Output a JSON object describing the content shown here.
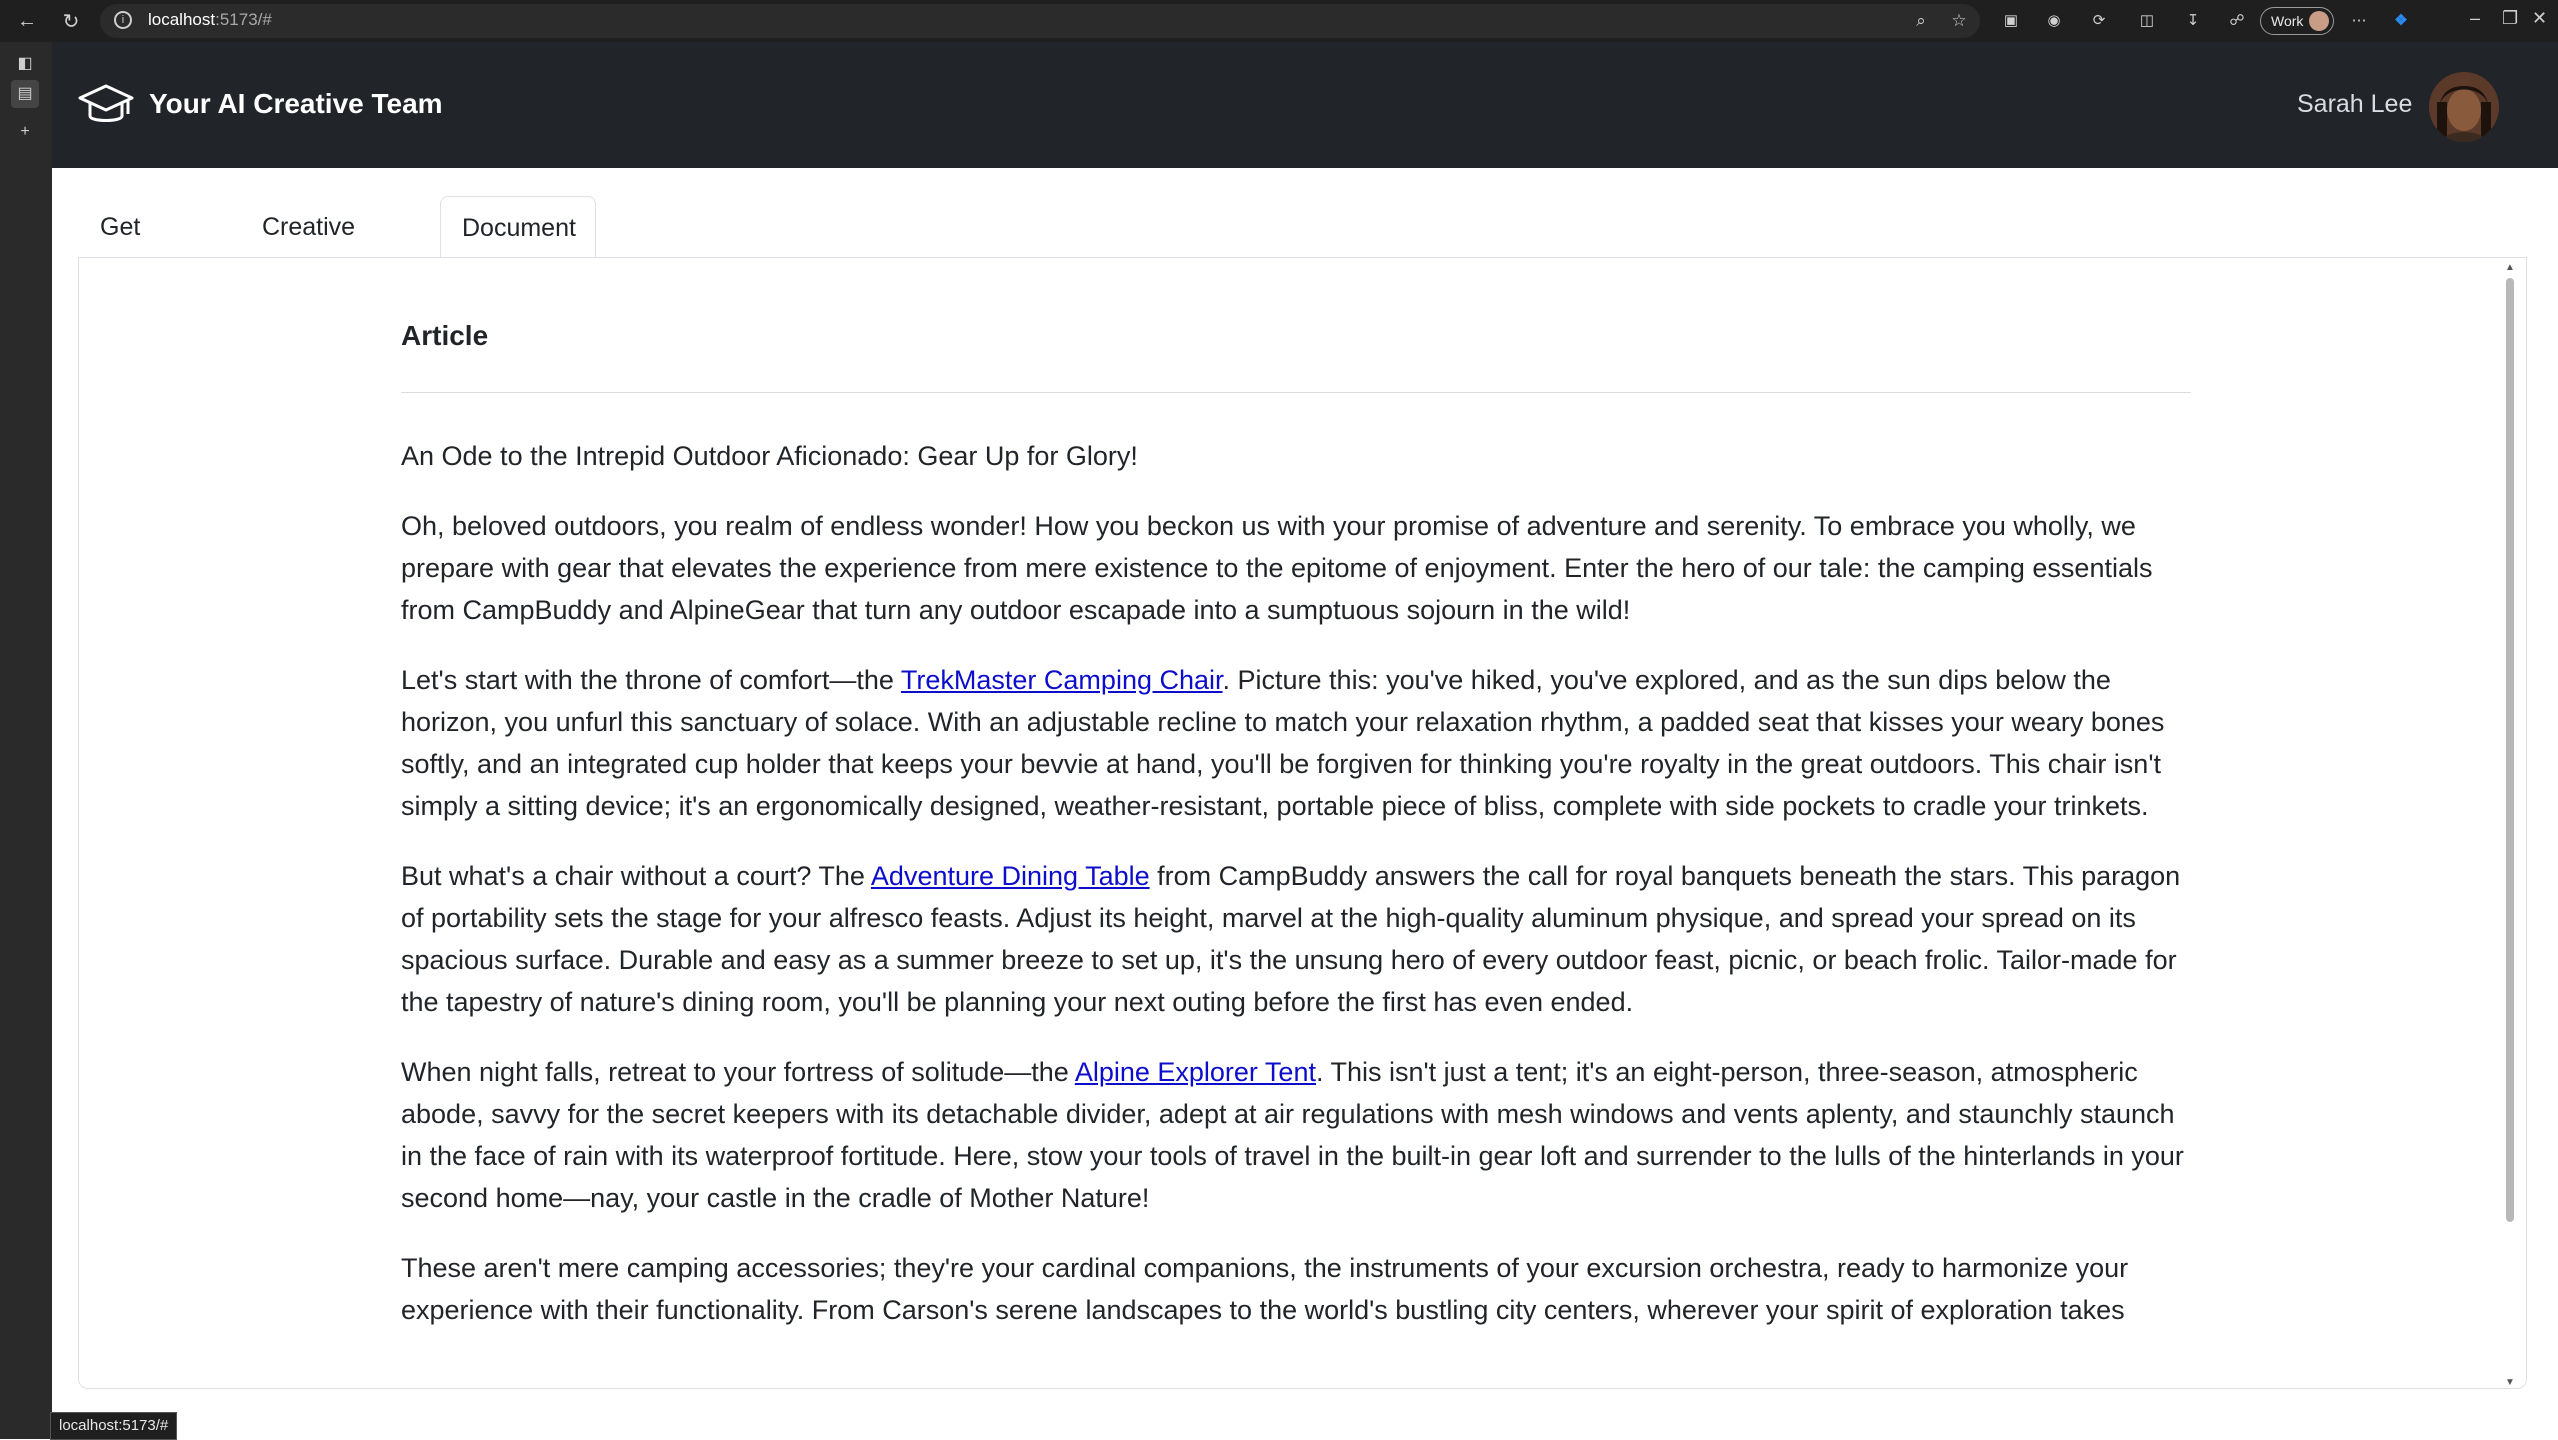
{
  "browser": {
    "url_host": "localhost",
    "url_rest": ":5173/#",
    "profile_label": "Work",
    "status_url": "localhost:5173/#"
  },
  "app": {
    "title": "Your AI Creative Team",
    "user_name": "Sarah Lee"
  },
  "tabs": [
    {
      "label": "Get Started"
    },
    {
      "label": "Creative Team"
    },
    {
      "label": "Document"
    }
  ],
  "document": {
    "heading": "Article",
    "title": "An Ode to the Intrepid Outdoor Aficionado: Gear Up for Glory!",
    "p1": "Oh, beloved outdoors, you realm of endless wonder! How you beckon us with your promise of adventure and serenity. To embrace you wholly, we prepare with gear that elevates the experience from mere existence to the epitome of enjoyment. Enter the hero of our tale: the camping essentials from CampBuddy and AlpineGear that turn any outdoor escapade into a sumptuous sojourn in the wild!",
    "p2_before": "Let's start with the throne of comfort—the ",
    "p2_link": "TrekMaster Camping Chair",
    "p2_after": ". Picture this: you've hiked, you've explored, and as the sun dips below the horizon, you unfurl this sanctuary of solace. With an adjustable recline to match your relaxation rhythm, a padded seat that kisses your weary bones softly, and an integrated cup holder that keeps your bevvie at hand, you'll be forgiven for thinking you're royalty in the great outdoors. This chair isn't simply a sitting device; it's an ergonomically designed, weather-resistant, portable piece of bliss, complete with side pockets to cradle your trinkets.",
    "p3_before": "But what's a chair without a court? The ",
    "p3_link": "Adventure Dining Table",
    "p3_after": " from CampBuddy answers the call for royal banquets beneath the stars. This paragon of portability sets the stage for your alfresco feasts. Adjust its height, marvel at the high-quality aluminum physique, and spread your spread on its spacious surface. Durable and easy as a summer breeze to set up, it's the unsung hero of every outdoor feast, picnic, or beach frolic. Tailor-made for the tapestry of nature's dining room, you'll be planning your next outing before the first has even ended.",
    "p4_before": "When night falls, retreat to your fortress of solitude—the ",
    "p4_link": "Alpine Explorer Tent",
    "p4_after": ". This isn't just a tent; it's an eight-person, three-season, atmospheric abode, savvy for the secret keepers with its detachable divider, adept at air regulations with mesh windows and vents aplenty, and staunchly staunch in the face of rain with its waterproof fortitude. Here, stow your tools of travel in the built-in gear loft and surrender to the lulls of the hinterlands in your second home—nay, your castle in the cradle of Mother Nature!",
    "p5": "These aren't mere camping accessories; they're your cardinal companions, the instruments of your excursion orchestra, ready to harmonize your experience with their functionality. From Carson's serene landscapes to the world's bustling city centers, wherever your spirit of exploration takes"
  }
}
